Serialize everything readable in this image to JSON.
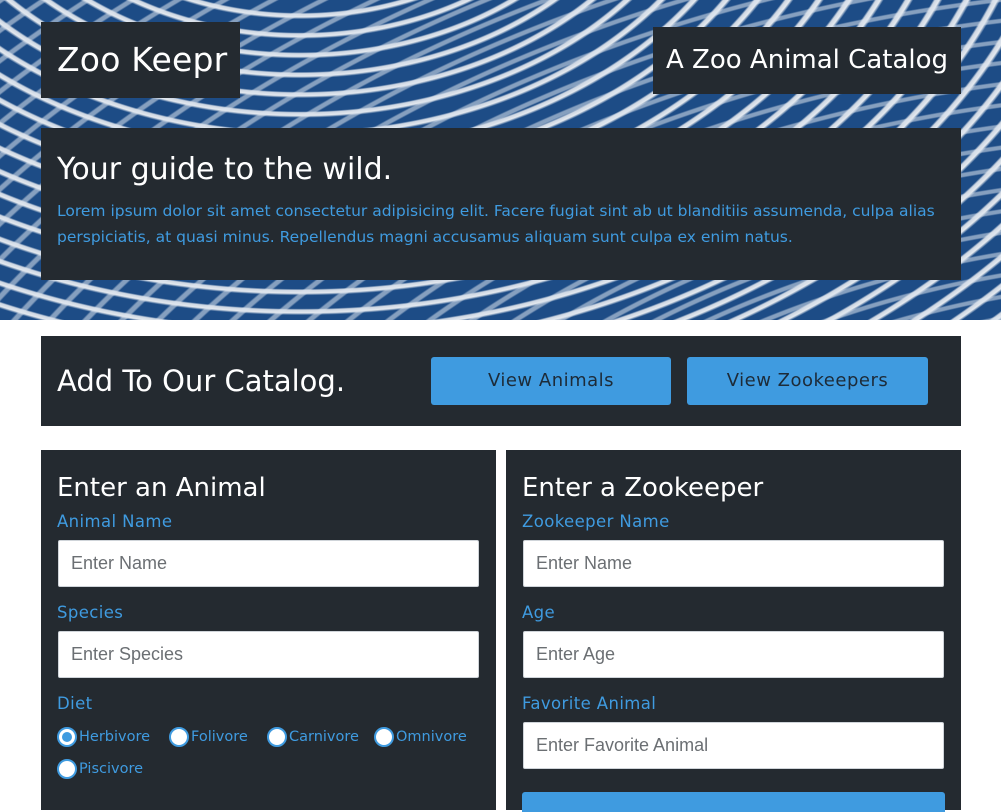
{
  "header": {
    "brand": "Zoo Keepr",
    "tagline": "A Zoo Animal Catalog"
  },
  "intro": {
    "heading": "Your guide to the wild.",
    "body": "Lorem ipsum dolor sit amet consectetur adipisicing elit. Facere fugiat sint ab ut blanditiis assumenda, culpa alias perspiciatis, at quasi minus. Repellendus magni accusamus aliquam sunt culpa ex enim natus."
  },
  "catalog": {
    "heading": "Add To Our Catalog.",
    "view_animals": "View Animals",
    "view_zookeepers": "View Zookeepers"
  },
  "animal_form": {
    "title": "Enter an Animal",
    "name_label": "Animal Name",
    "name_placeholder": "Enter Name",
    "species_label": "Species",
    "species_placeholder": "Enter Species",
    "diet_label": "Diet",
    "diet_options": [
      {
        "label": "Herbivore",
        "checked": true
      },
      {
        "label": "Folivore",
        "checked": false
      },
      {
        "label": "Carnivore",
        "checked": false
      },
      {
        "label": "Omnivore",
        "checked": false
      },
      {
        "label": "Piscivore",
        "checked": false
      }
    ]
  },
  "zookeeper_form": {
    "title": "Enter a Zookeeper",
    "name_label": "Zookeeper Name",
    "name_placeholder": "Enter Name",
    "age_label": "Age",
    "age_placeholder": "Enter Age",
    "favorite_label": "Favorite Animal",
    "favorite_placeholder": "Enter Favorite Animal"
  },
  "colors": {
    "panel": "#242a30",
    "accent": "#3f9be0",
    "stripe_blue": "#1d4c86"
  }
}
